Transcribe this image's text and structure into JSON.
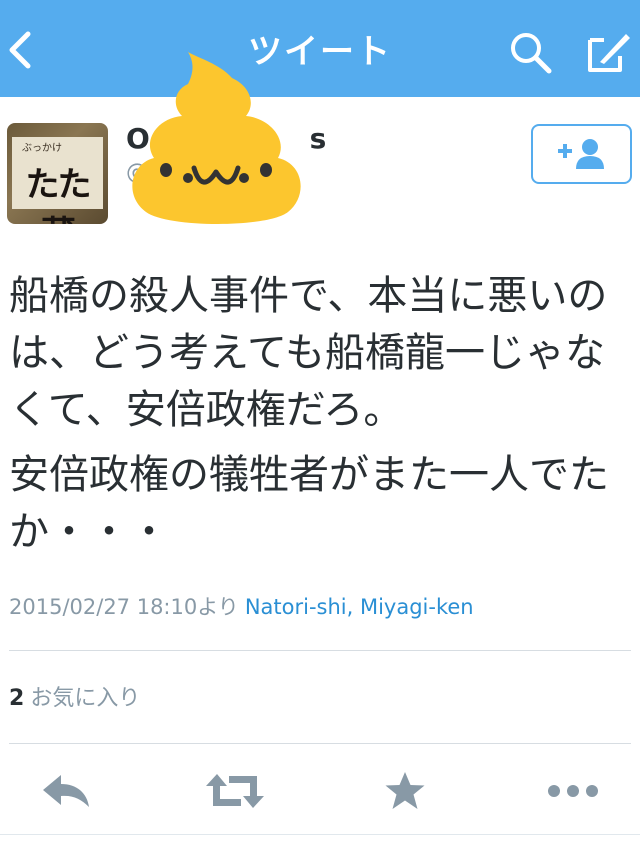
{
  "navbar": {
    "title": "ツイート",
    "back_icon": "chevron-left-icon",
    "search_icon": "search-icon",
    "compose_icon": "compose-icon"
  },
  "profile": {
    "avatar_sign_text": "たた蔵",
    "avatar_small_text": "ぶっかけ",
    "name_visible": "O",
    "name_trailing": "s",
    "handle_visible": "@",
    "follow_icon": "follow-user-icon"
  },
  "tweet": {
    "paragraphs": [
      "船橋の殺人事件で、本当に悪いのは、どう考えても船橋龍一じゃなくて、安倍政権だろ。",
      "安倍政権の犠牲者がまた一人でたか・・・"
    ],
    "timestamp": "2015/02/27 18:10より",
    "location": "Natori-shi, Miyagi-ken"
  },
  "stats": {
    "favorites_count": "2",
    "favorites_label": "お気に入り"
  },
  "actions": {
    "reply_icon": "reply-icon",
    "retweet_icon": "retweet-icon",
    "favorite_icon": "star-icon",
    "more_icon": "more-icon"
  },
  "colors": {
    "navbar": "#55acee",
    "accent": "#55acee",
    "link": "#2a8fd4",
    "action_gray": "#8899a6",
    "overlay_yellow": "#fcc62e"
  }
}
